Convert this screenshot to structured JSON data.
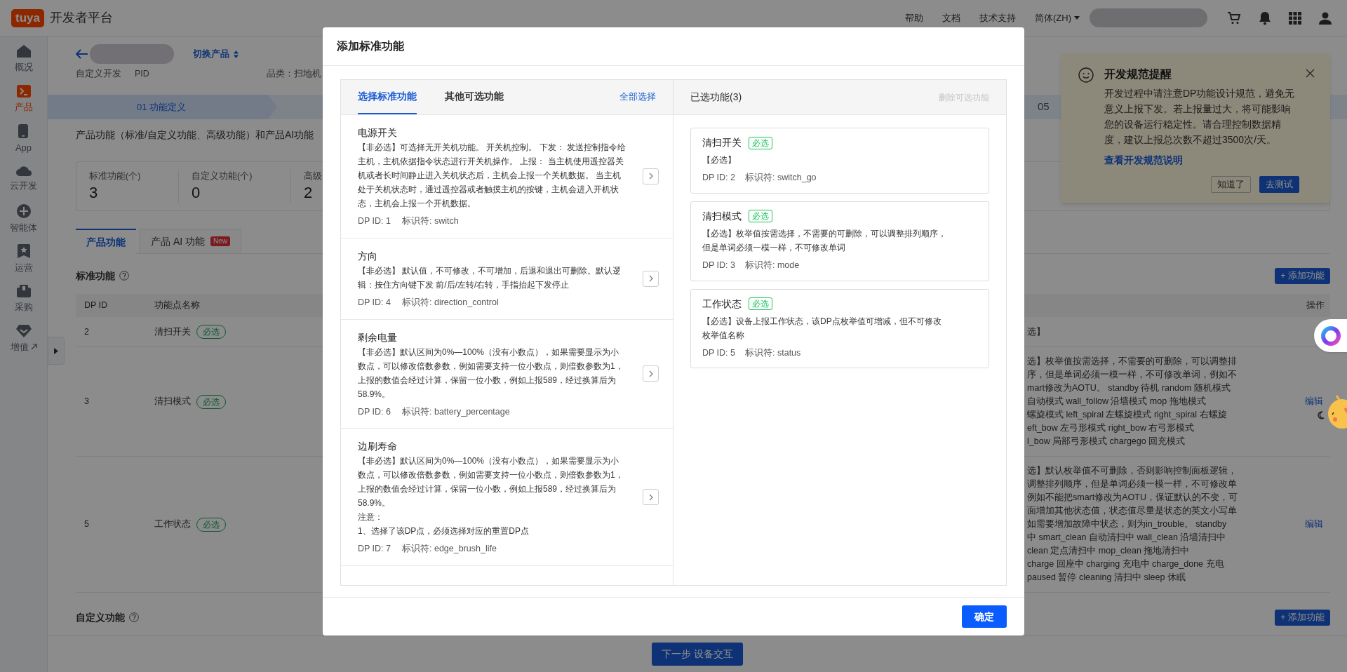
{
  "topbar": {
    "logo": "tuya",
    "title": "开发者平台",
    "links": [
      "帮助",
      "文档",
      "技术支持"
    ],
    "language": "简体(ZH)"
  },
  "sidebar": {
    "items": [
      {
        "label": "概况",
        "kind": "page",
        "selected": false
      },
      {
        "label": "产品",
        "kind": "page",
        "selected": true
      },
      {
        "label": "App",
        "kind": "page",
        "selected": false
      },
      {
        "label": "云开发",
        "kind": "page",
        "selected": false
      },
      {
        "label": "智能体",
        "kind": "page",
        "selected": false
      },
      {
        "label": "运营",
        "kind": "page",
        "selected": false
      },
      {
        "label": "采购",
        "kind": "page",
        "selected": false
      },
      {
        "label": "增值",
        "kind": "external",
        "selected": false
      }
    ]
  },
  "product_header": {
    "switch_label": "切换产品",
    "type": "自定义开发",
    "pid_label": "PID",
    "category": "品类：扫地机"
  },
  "steps": [
    {
      "label": "01 功能定义"
    },
    {
      "label": "05"
    }
  ],
  "section_title": "产品功能（标准/自定义功能、高级功能）和产品AI功能",
  "stats": [
    {
      "label": "标准功能(个)",
      "value": "3"
    },
    {
      "label": "自定义功能(个)",
      "value": "0"
    },
    {
      "label": "高级",
      "value": "2"
    }
  ],
  "tabs": [
    {
      "label": "产品功能",
      "selected": true
    },
    {
      "label": "产品 AI 功能",
      "badge": "New",
      "selected": false
    }
  ],
  "standard": {
    "title": "标准功能",
    "add_button": "+ 添加功能",
    "columns": [
      "DP ID",
      "功能点名称",
      "操作"
    ],
    "rows": [
      {
        "dp_id": "2",
        "name": "清扫开关",
        "tag": "必选",
        "description": [
          "选】"
        ]
      },
      {
        "dp_id": "3",
        "name": "清扫模式",
        "tag": "必选",
        "description": [
          "选】枚举值按需选择，不需要的可删除，可以调整排",
          "序，但是单词必须一模一样，不可修改单词，例如不",
          "mart修改为AOTU。 standby 待机 random 随机模式",
          "自动模式 wall_follow 沿墙模式 mop 拖地模式",
          "螺旋模式 left_spiral 左螺旋模式 right_spiral 右螺旋",
          "eft_bow 左弓形模式 right_bow 右弓形模式",
          "l_bow 局部弓形模式 chargego 回充模式"
        ],
        "action": "编辑"
      },
      {
        "dp_id": "5",
        "name": "工作状态",
        "tag": "必选",
        "description": [
          "选】默认枚举值不可删除，否则影响控制面板逻辑，",
          "调整排列顺序，但是单词必须一模一样，不可修改单",
          "例如不能把smart修改为AOTU，保证默认的不变，可",
          "面增加其他状态值，状态值尽量是状态的英文小写单",
          "如需要增加故障中状态，则为in_trouble。 standby",
          "中 smart_clean 自动清扫中 wall_clean 沿墙清扫中",
          "clean 定点清扫中 mop_clean 拖地清扫中",
          "charge 回座中 charging 充电中 charge_done 充电",
          "paused 暂停 cleaning 清扫中 sleep 休眠"
        ],
        "action": "编辑"
      }
    ]
  },
  "custom": {
    "title": "自定义功能",
    "add_button": "+ 添加功能"
  },
  "next_button": "下一步 设备交互",
  "notice": {
    "title": "开发规范提醒",
    "body": "开发过程中请注意DP功能设计规范，避免无意义上报下发。若上报量过大，将可能影响您的设备运行稳定性。请合理控制数据精度，建议上报总次数不超过3500次/天。",
    "link": "查看开发规范说明",
    "buttons": [
      {
        "label": "知道了",
        "kind": "secondary"
      },
      {
        "label": "去测试",
        "kind": "primary"
      }
    ]
  },
  "modal": {
    "title": "添加标准功能",
    "tabs": [
      {
        "label": "选择标准功能",
        "selected": true
      },
      {
        "label": "其他可选功能",
        "selected": false
      }
    ],
    "select_all": "全部选择",
    "functions": [
      {
        "name": "电源开关",
        "description": [
          "【非必选】可选择无开关机功能。 开关机控制。 下发： 发送控制指令给主机，主机依据指令状态进行开关机操作。 上报： 当主机使用遥控器关机或者长时间静止进入关机状态后，主机会上报一个关机数据。 当主机处于关机状态时，通过遥控器或者触摸主机的按键，主机会进入开机状态，主机会上报一个开机数据。"
        ],
        "dp_id": "DP ID: 1",
        "identifier": "标识符: switch"
      },
      {
        "name": "方向",
        "description": [
          "【非必选】 默认值，不可修改，不可增加，后退和退出可删除。默认逻辑：按住方向键下发 前/后/左转/右转，手指抬起下发停止"
        ],
        "dp_id": "DP ID: 4",
        "identifier": "标识符: direction_control"
      },
      {
        "name": "剩余电量",
        "description": [
          "【非必选】默认区间为0%—100%（没有小数点），如果需要显示为小数点，可以修改倍数参数，例如需要支持一位小数点，则倍数参数为1，上报的数值会经过计算，保留一位小数，例如上报589，经过换算后为58.9%。"
        ],
        "dp_id": "DP ID: 6",
        "identifier": "标识符: battery_percentage"
      },
      {
        "name": "边刷寿命",
        "description": [
          "【非必选】默认区间为0%—100%（没有小数点），如果需要显示为小数点，可以修改倍数参数，例如需要支持一位小数点，则倍数参数为1，上报的数值会经过计算，保留一位小数，例如上报589，经过换算后为58.9%。",
          "注意：",
          "1、选择了该DP点，必须选择对应的重置DP点"
        ],
        "dp_id": "DP ID: 7",
        "identifier": "标识符: edge_brush_life"
      }
    ],
    "selected_title": "已选功能(3)",
    "remove_optional": {
      "label": "删除可选功能",
      "disabled": true
    },
    "selected_functions": [
      {
        "name": "清扫开关",
        "tag": "必选",
        "description": "【必选】",
        "dp_id": "DP ID: 2",
        "identifier": "标识符: switch_go"
      },
      {
        "name": "清扫模式",
        "tag": "必选",
        "description": "【必选】枚举值按需选择，不需要的可删除，可以调整排列顺序，但是单词必须一模一样，不可修改单词",
        "dp_id": "DP ID: 3",
        "identifier": "标识符: mode"
      },
      {
        "name": "工作状态",
        "tag": "必选",
        "description": "【必选】设备上报工作状态，该DP点枚举值可增减，但不可修改枚举值名称",
        "dp_id": "DP ID: 5",
        "identifier": "标识符: status"
      }
    ],
    "confirm": "确定"
  }
}
